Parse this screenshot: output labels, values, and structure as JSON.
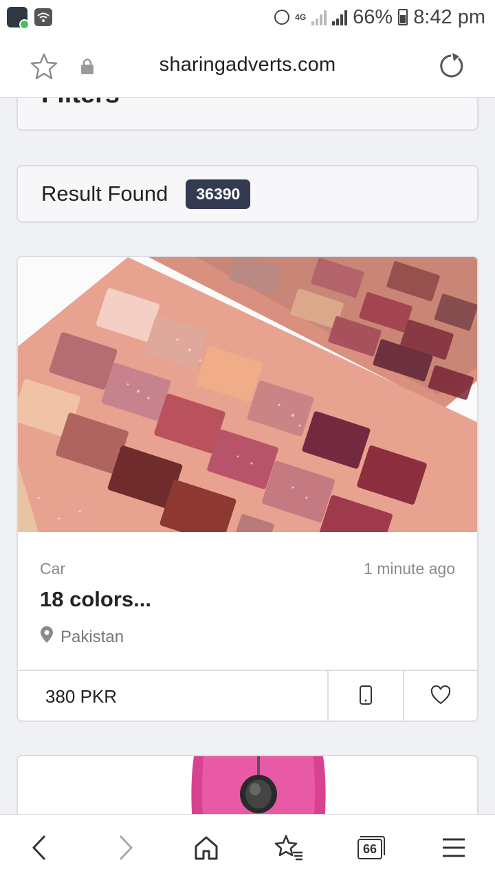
{
  "status_bar": {
    "network": "4G",
    "battery": "66%",
    "time": "8:42 pm",
    "icons": [
      "app-notification-icon",
      "wifi-icon",
      "globe-icon",
      "signal-icon",
      "battery-icon"
    ]
  },
  "browser": {
    "url": "sharingadverts.com",
    "icons": [
      "star-icon",
      "lock-icon",
      "reload-icon"
    ]
  },
  "filters": {
    "title_partial": "Filters"
  },
  "results": {
    "label": "Result Found",
    "count": "36390"
  },
  "listing": {
    "category": "Car",
    "time_ago": "1 minute ago",
    "title": "18 colors...",
    "location": "Pakistan",
    "price": "380 PKR",
    "icons": [
      "location-pin-icon",
      "phone-icon",
      "heart-icon"
    ]
  },
  "bottom_nav": {
    "tab_count": "66",
    "icons": [
      "back-icon",
      "forward-icon",
      "home-icon",
      "bookmarks-icon",
      "tabs-icon",
      "menu-icon"
    ]
  },
  "colors": {
    "badge_bg": "#343a4f",
    "page_bg": "#f0f1f5",
    "card_border": "#dcdde1",
    "palette_pink": "#e9b09e"
  }
}
